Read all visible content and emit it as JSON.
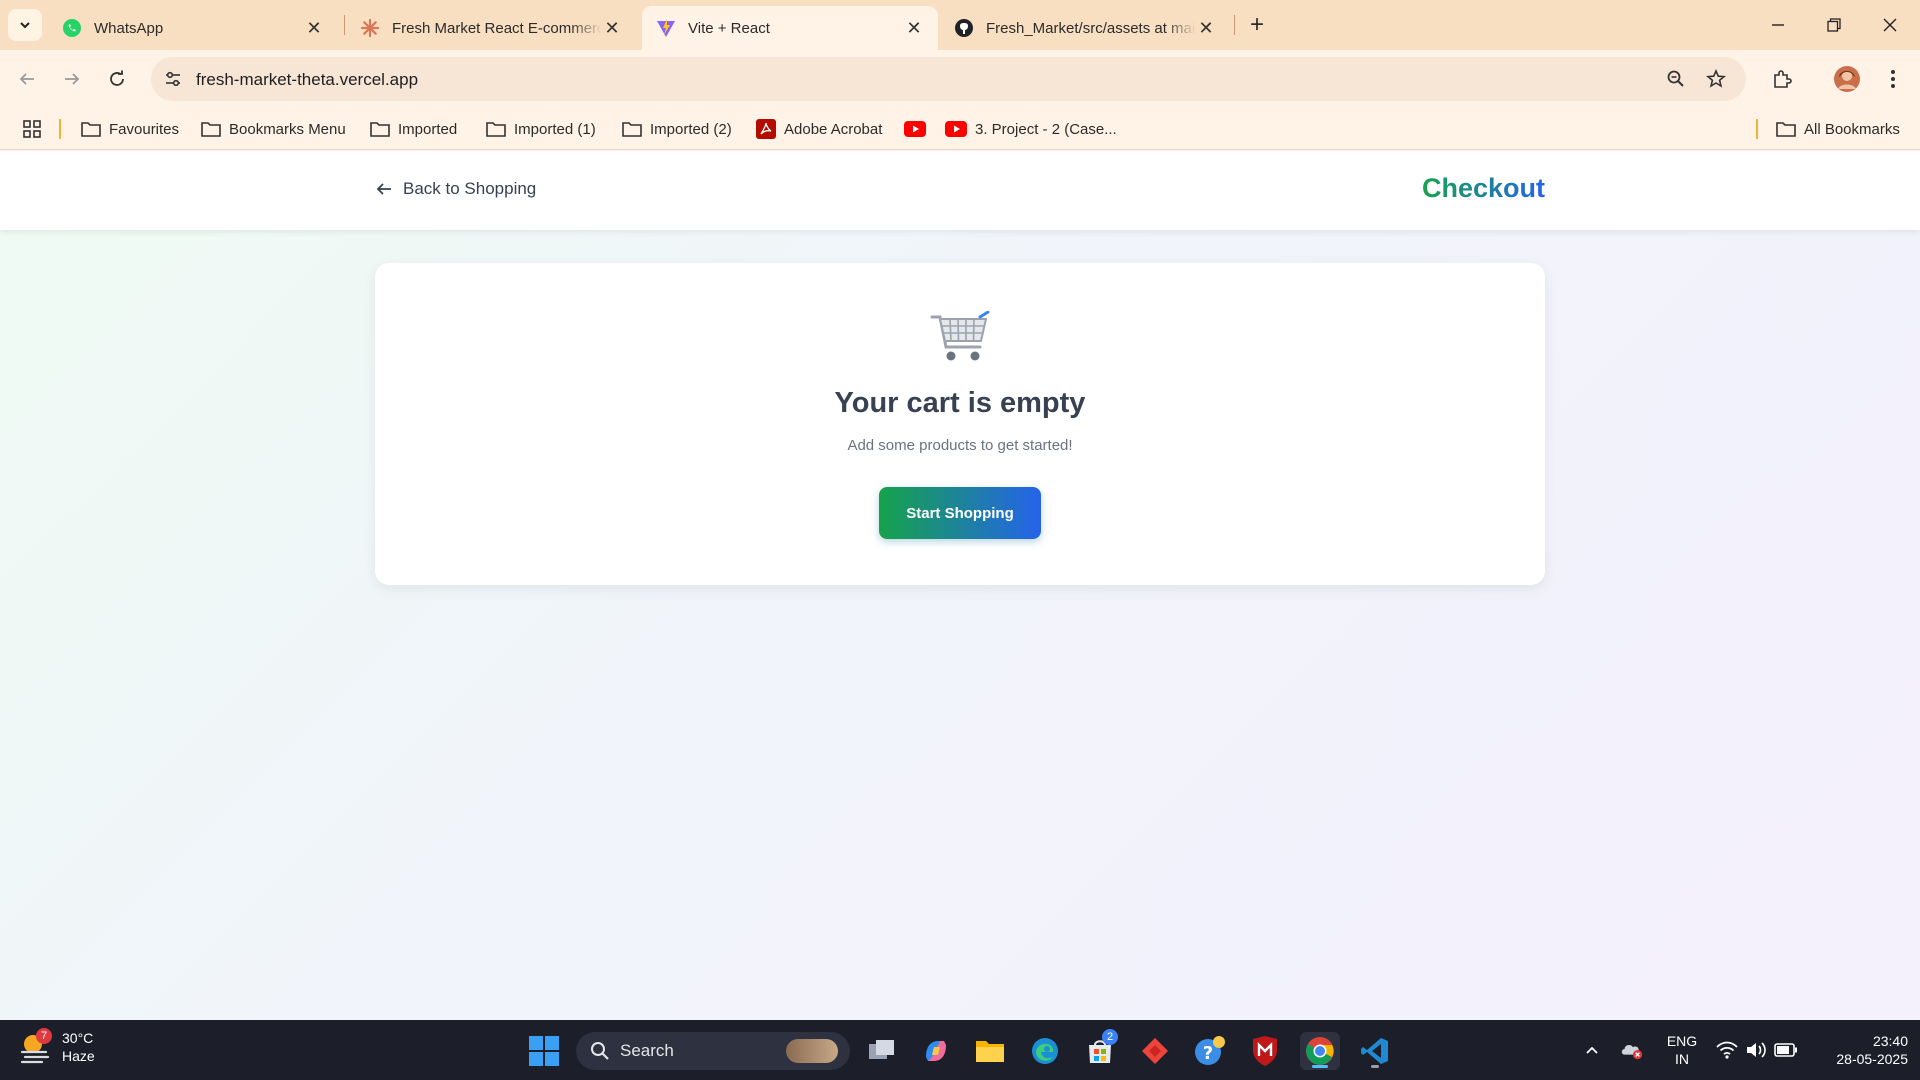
{
  "browser": {
    "tabs": [
      {
        "title": "WhatsApp",
        "icon": "whatsapp-icon"
      },
      {
        "title": "Fresh Market React E-commerce",
        "icon": "claude-icon"
      },
      {
        "title": "Vite + React",
        "icon": "vite-icon"
      },
      {
        "title": "Fresh_Market/src/assets at main",
        "icon": "github-icon"
      }
    ],
    "url": "fresh-market-theta.vercel.app",
    "bookmarks": [
      {
        "label": "Favourites",
        "icon": "folder-icon"
      },
      {
        "label": "Bookmarks Menu",
        "icon": "folder-icon"
      },
      {
        "label": "Imported",
        "icon": "folder-icon"
      },
      {
        "label": "Imported (1)",
        "icon": "folder-icon"
      },
      {
        "label": "Imported (2)",
        "icon": "folder-icon"
      },
      {
        "label": "Adobe Acrobat",
        "icon": "acrobat-icon"
      },
      {
        "label": "",
        "icon": "youtube-icon"
      },
      {
        "label": "3. Project - 2 (Case...",
        "icon": "youtube-icon"
      }
    ],
    "all_bookmarks": "All Bookmarks"
  },
  "page": {
    "back_label": "Back to Shopping",
    "header_title": "Checkout",
    "empty_title": "Your cart is empty",
    "empty_subtitle": "Add some products to get started!",
    "start_button": "Start Shopping",
    "accent_green": "#16a34a",
    "accent_blue": "#2563eb"
  },
  "taskbar": {
    "weather_temp": "30°C",
    "weather_desc": "Haze",
    "weather_badge": "7",
    "search_label": "Search",
    "store_badge": "2",
    "lang_top": "ENG",
    "lang_bottom": "IN",
    "time": "23:40",
    "date": "28-05-2025"
  }
}
